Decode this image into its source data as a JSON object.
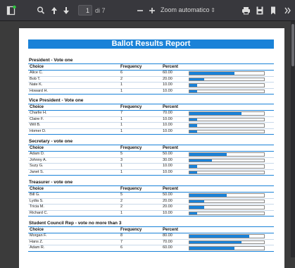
{
  "toolbar": {
    "page_current": "1",
    "page_total_label": "di 7",
    "zoom_label": "Zoom automatico",
    "zoom_arrow": "⇕"
  },
  "report": {
    "title": "Ballot Results Report",
    "headers": {
      "choice": "Choice",
      "frequency": "Frequency",
      "percent": "Percent"
    },
    "sections": [
      {
        "title": "President - Vote one",
        "rows": [
          {
            "choice": "Alice C.",
            "frequency": "6",
            "percent": "60.00",
            "fraction": 0.6
          },
          {
            "choice": "Bob T.",
            "frequency": "2",
            "percent": "20.00",
            "fraction": 0.2
          },
          {
            "choice": "Nate K.",
            "frequency": "1",
            "percent": "10.00",
            "fraction": 0.1
          },
          {
            "choice": "Howard H.",
            "frequency": "1",
            "percent": "10.00",
            "fraction": 0.1
          }
        ]
      },
      {
        "title": "Vice President - Vote one",
        "rows": [
          {
            "choice": "Charlie H.",
            "frequency": "7",
            "percent": "70.00",
            "fraction": 0.7
          },
          {
            "choice": "Claire F.",
            "frequency": "1",
            "percent": "10.00",
            "fraction": 0.1
          },
          {
            "choice": "Will B.",
            "frequency": "1",
            "percent": "10.00",
            "fraction": 0.1
          },
          {
            "choice": "Homer D.",
            "frequency": "1",
            "percent": "10.00",
            "fraction": 0.1
          }
        ]
      },
      {
        "title": "Secretary - vote one",
        "rows": [
          {
            "choice": "Adam D.",
            "frequency": "5",
            "percent": "50.00",
            "fraction": 0.5
          },
          {
            "choice": "Johnny A.",
            "frequency": "3",
            "percent": "30.00",
            "fraction": 0.3
          },
          {
            "choice": "Suzy G.",
            "frequency": "1",
            "percent": "10.00",
            "fraction": 0.1
          },
          {
            "choice": "Janet S.",
            "frequency": "1",
            "percent": "10.00",
            "fraction": 0.1
          }
        ]
      },
      {
        "title": "Treasurer - vote one",
        "rows": [
          {
            "choice": "Bill G.",
            "frequency": "5",
            "percent": "50.00",
            "fraction": 0.5
          },
          {
            "choice": "Lydia S.",
            "frequency": "2",
            "percent": "20.00",
            "fraction": 0.2
          },
          {
            "choice": "Tricia M.",
            "frequency": "2",
            "percent": "20.00",
            "fraction": 0.2
          },
          {
            "choice": "Richard C.",
            "frequency": "1",
            "percent": "10.00",
            "fraction": 0.1
          }
        ]
      },
      {
        "title": "Student Council Rep - vote no more than 3",
        "rows": [
          {
            "choice": "Morgan F.",
            "frequency": "8",
            "percent": "80.00",
            "fraction": 0.8
          },
          {
            "choice": "Hans Z.",
            "frequency": "7",
            "percent": "70.00",
            "fraction": 0.7
          },
          {
            "choice": "Adam R.",
            "frequency": "6",
            "percent": "60.00",
            "fraction": 0.6
          }
        ]
      }
    ]
  },
  "colors": {
    "accent": "#1a82d8",
    "toolbar": "#38383d",
    "viewer_bg": "#3b3b3b"
  }
}
